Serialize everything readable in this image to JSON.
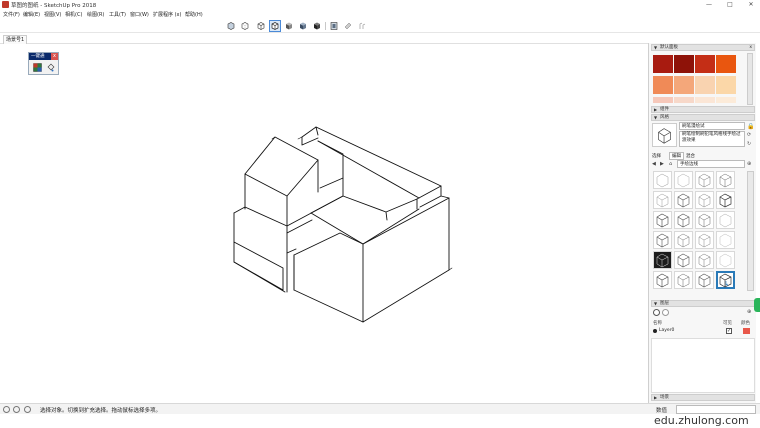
{
  "window": {
    "title": "草图的图纸 - SketchUp Pro 2018",
    "controls": {
      "minimize": "—",
      "maximize": "□",
      "close": "✕"
    }
  },
  "menu": [
    "文件(F)",
    "编辑(E)",
    "视图(V)",
    "相机(C)",
    "绘图(R)",
    "工具(T)",
    "窗口(W)",
    "扩展程序 (x)",
    "帮助(H)"
  ],
  "toolbar": {
    "icons": [
      "xray-style-icon",
      "back-edges-style-icon",
      "wireframe-style-icon",
      "hidden-line-style-icon",
      "shaded-style-icon",
      "shaded-textures-style-icon",
      "monochrome-style-icon",
      "section-plane-icon",
      "section-display-icon",
      "section-cut-icon"
    ],
    "active_index": 3
  },
  "scene_tab": "场景号1",
  "floating_toolbar": {
    "title": "一键通",
    "close": "x"
  },
  "tray": {
    "materials": {
      "title": "默认面板",
      "colors": [
        "#a81b10",
        "#8e1208",
        "#c42e16",
        "#e9560f",
        "#f08a57",
        "#f4a77a",
        "#f9d3b0",
        "#fbd7a8",
        "#f6c8ba",
        "#f7d8c9",
        "#fbe6d6",
        "#fcebd9"
      ]
    },
    "components_title": "组件",
    "styles": {
      "title": "风格",
      "name": "刷笔漫绘试",
      "description": "刷笔绘制刷铅笔风格线手绘过渡效果",
      "tabs": [
        "选择",
        "编辑",
        "混合"
      ],
      "collection": "手绘边线"
    },
    "layers": {
      "title": "图层",
      "columns": {
        "name": "名称",
        "visible": "可见",
        "color": "颜色"
      },
      "rows": [
        {
          "name": "Layer0",
          "visible": true,
          "color": "#e8574a"
        }
      ]
    },
    "scenes_title": "场景"
  },
  "status": {
    "text": "选择对象。切换到扩充选择。拖动鼠标选择多项。",
    "measure_label": "数值",
    "measure_value": ""
  },
  "watermark": "edu.zhulong.com"
}
